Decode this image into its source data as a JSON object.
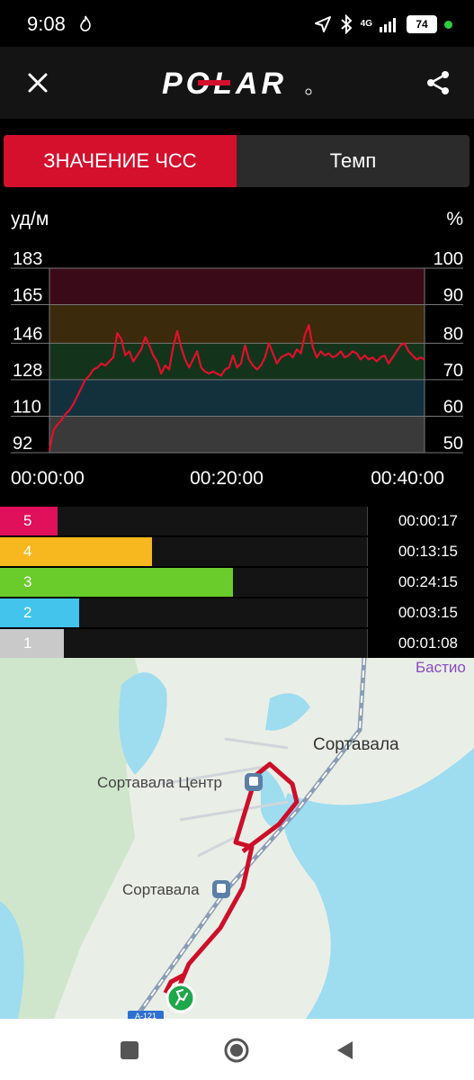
{
  "status_bar": {
    "time": "9:08",
    "network": "4G",
    "battery": "74"
  },
  "app_bar": {
    "logo_text": "POLAR"
  },
  "tabs": [
    {
      "label": "ЗНАЧЕНИЕ ЧСС",
      "active": true
    },
    {
      "label": "Темп",
      "active": false
    }
  ],
  "chart_data": {
    "type": "line",
    "left_axis_unit": "уд/м",
    "right_axis_unit": "%",
    "y_ticks_left": [
      "183",
      "165",
      "146",
      "128",
      "110",
      "92"
    ],
    "y_ticks_right": [
      "100",
      "90",
      "80",
      "70",
      "60",
      "50"
    ],
    "ylim": [
      92,
      183
    ],
    "x_ticks": [
      "00:00:00",
      "00:20:00",
      "00:40:00"
    ],
    "xlim_minutes": [
      0,
      47
    ],
    "zone_colors": [
      "#3a3a3a",
      "#13313d",
      "#13341a",
      "#3b2a0c",
      "#3a0a19"
    ],
    "line_color": "#e0102c",
    "series": [
      {
        "x": [
          0,
          0.5,
          1,
          1.5,
          2,
          2.5,
          3,
          3.5,
          4,
          4.5,
          5,
          5.5,
          6,
          6.5,
          7,
          7.5,
          8,
          8.5,
          9,
          9.5,
          10,
          10.5,
          11,
          11.5,
          12,
          12.5,
          13,
          13.5,
          14,
          14.5,
          15,
          15.5,
          16,
          16.5,
          17,
          17.5,
          18,
          18.5,
          19,
          19.5,
          20,
          20.5,
          21,
          21.5,
          22,
          22.5,
          23,
          23.5,
          24,
          24.5,
          25,
          25.5,
          26,
          26.5,
          27,
          27.5,
          28,
          28.5,
          29,
          29.5,
          30,
          30.5,
          31,
          31.5,
          32,
          32.5,
          33,
          33.5,
          34,
          34.5,
          35,
          35.5,
          36,
          36.5,
          37,
          37.5,
          38,
          38.5,
          39,
          39.5,
          40,
          40.5,
          41,
          41.5,
          42,
          42.5,
          43,
          43.5,
          44,
          44.5,
          45,
          45.5,
          46,
          46.5,
          47
        ],
        "y": [
          93,
          103,
          106,
          108,
          111,
          113,
          116,
          120,
          124,
          128,
          130,
          133,
          134,
          136,
          135,
          137,
          139,
          151,
          148,
          140,
          142,
          137,
          140,
          143,
          149,
          145,
          140,
          137,
          131,
          135,
          133,
          144,
          152,
          144,
          138,
          134,
          138,
          142,
          134,
          132,
          131,
          132,
          131,
          130,
          133,
          134,
          140,
          134,
          136,
          145,
          138,
          135,
          133,
          135,
          139,
          146,
          141,
          136,
          139,
          140,
          141,
          139,
          143,
          141,
          150,
          155,
          144,
          139,
          142,
          140,
          141,
          139,
          140,
          142,
          139,
          140,
          142,
          141,
          138,
          140,
          138,
          139,
          137,
          139,
          140,
          136,
          139,
          142,
          145,
          146,
          142,
          140,
          138,
          139,
          138
        ]
      }
    ]
  },
  "zones": [
    {
      "zone": "5",
      "time": "00:00:17",
      "color": "#e0105a",
      "label_bg": "#e0105a",
      "fraction": 0.006
    },
    {
      "zone": "4",
      "time": "00:13:15",
      "color": "#f7b71e",
      "label_bg": "#f7b71e",
      "fraction": 0.31
    },
    {
      "zone": "3",
      "time": "00:24:15",
      "color": "#6acc2a",
      "label_bg": "#6acc2a",
      "fraction": 0.57
    },
    {
      "zone": "2",
      "time": "00:03:15",
      "color": "#42c4ec",
      "label_bg": "#42c4ec",
      "fraction": 0.076
    },
    {
      "zone": "1",
      "time": "00:01:08",
      "color": "#c9c9c9",
      "label_bg": "#c9c9c9",
      "fraction": 0.027
    }
  ],
  "map": {
    "labels": {
      "sortavala_top": "Сортавала",
      "sortavala_center": "Сортавала Центр",
      "sortavala_station": "Сортавала",
      "bastion": "Бастио",
      "road": "А-121"
    }
  },
  "nav": {
    "back_icon": "triangle-back-icon",
    "home_icon": "circle-home-icon",
    "recents_icon": "square-recents-icon"
  }
}
